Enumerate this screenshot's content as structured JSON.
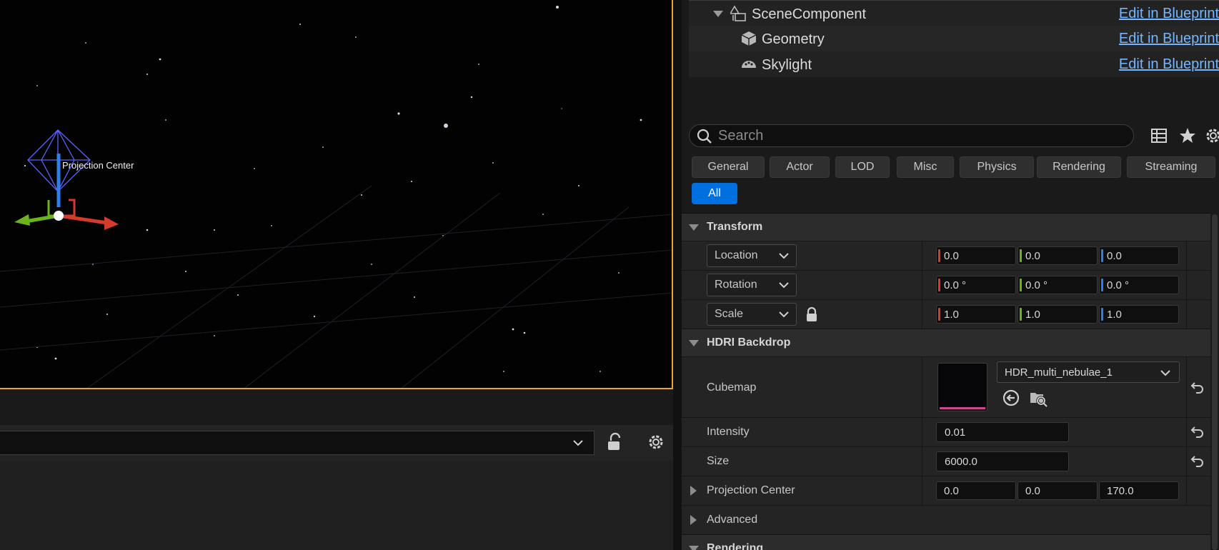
{
  "viewport": {
    "gizmo_label": "Projection Center"
  },
  "components": [
    {
      "name": "SceneComponent",
      "icon": "scene-component-icon",
      "action": "Edit in Blueprint"
    },
    {
      "name": "Geometry",
      "icon": "cube-icon",
      "action": "Edit in Blueprint"
    },
    {
      "name": "Skylight",
      "icon": "skylight-icon",
      "action": "Edit in Blueprint"
    }
  ],
  "search": {
    "placeholder": "Search"
  },
  "categories": [
    "General",
    "Actor",
    "LOD",
    "Misc",
    "Physics",
    "Rendering",
    "Streaming"
  ],
  "category_active": "All",
  "transform": {
    "title": "Transform",
    "location": {
      "label": "Location",
      "x": "0.0",
      "y": "0.0",
      "z": "0.0"
    },
    "rotation": {
      "label": "Rotation",
      "x": "0.0 °",
      "y": "0.0 °",
      "z": "0.0 °"
    },
    "scale": {
      "label": "Scale",
      "x": "1.0",
      "y": "1.0",
      "z": "1.0"
    }
  },
  "hdri": {
    "title": "HDRI Backdrop",
    "cubemap": {
      "label": "Cubemap",
      "value": "HDR_multi_nebulae_1"
    },
    "intensity": {
      "label": "Intensity",
      "value": "0.01"
    },
    "size": {
      "label": "Size",
      "value": "6000.0"
    },
    "projection_center": {
      "label": "Projection Center",
      "x": "0.0",
      "y": "0.0",
      "z": "170.0"
    },
    "advanced": {
      "label": "Advanced"
    }
  },
  "rendering": {
    "title": "Rendering"
  },
  "colors": {
    "accent": "#0070e0",
    "x_axis": "#d43b2a",
    "y_axis": "#6cb41c",
    "z_axis": "#2f7fe8",
    "viewport_border": "#e8a33a",
    "link": "#74b6ff"
  }
}
